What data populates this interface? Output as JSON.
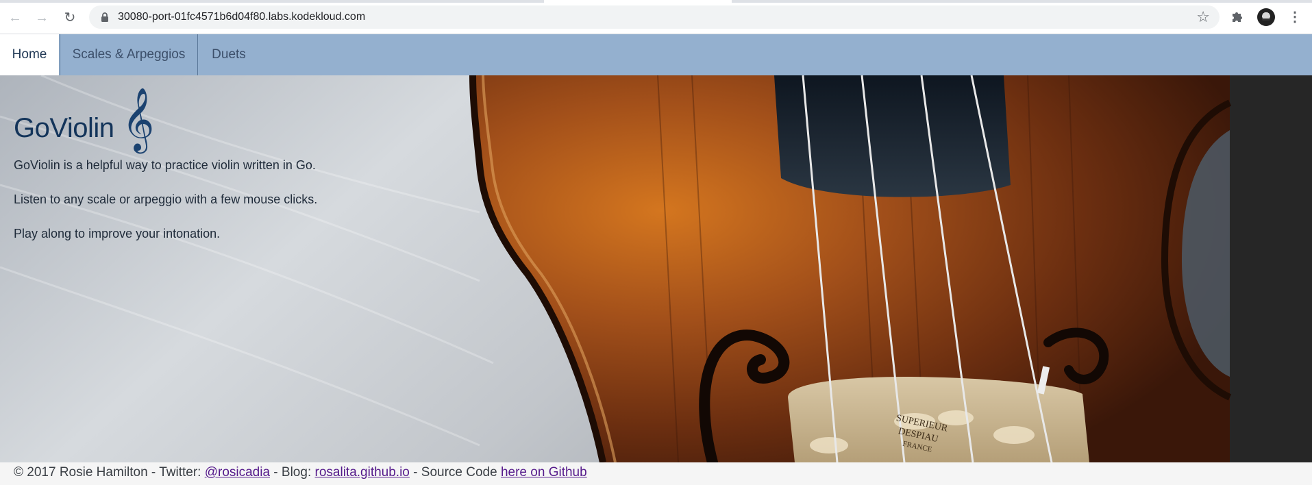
{
  "browser": {
    "url": "30080-port-01fc4571b6d04f80.labs.kodekloud.com",
    "back_icon": "arrow-left",
    "forward_icon": "arrow-right",
    "reload_icon": "reload",
    "star_icon": "star-outline",
    "extensions_icon": "puzzle-piece",
    "menu_icon": "vertical-dots"
  },
  "nav": {
    "tabs": [
      {
        "label": "Home",
        "active": true
      },
      {
        "label": "Scales & Arpeggios",
        "active": false
      },
      {
        "label": "Duets",
        "active": false
      }
    ]
  },
  "hero": {
    "title": "GoViolin",
    "clef_glyph": "𝄞",
    "paragraphs": [
      "GoViolin is a helpful way to practice violin written in Go.",
      "Listen to any scale or arpeggio with a few mouse clicks.",
      "Play along to improve your intonation."
    ],
    "engraving": [
      "SUPERIEUR",
      "DESPIAU",
      "FRANCE"
    ]
  },
  "footer": {
    "copyright": "© 2017 Rosie Hamilton - Twitter: ",
    "twitter_link": "@rosicadia",
    "blog_prefix": " - Blog: ",
    "blog_link": "rosalita.github.io",
    "source_prefix": " - Source Code ",
    "source_link": "here on Github"
  },
  "colors": {
    "nav_bg": "#94b0cf",
    "title": "#13345a",
    "link": "#1a0dab",
    "visited_link": "#551a8b"
  }
}
